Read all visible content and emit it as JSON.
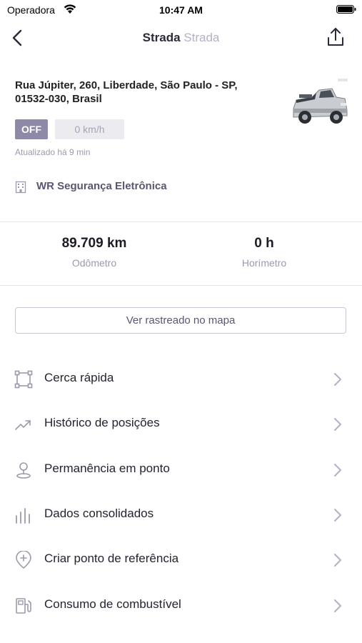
{
  "status_bar": {
    "carrier": "Operadora",
    "time": "10:47 AM"
  },
  "nav": {
    "title": "Strada",
    "subtitle": "Strada"
  },
  "vehicle": {
    "address": "Rua Júpiter, 260, Liberdade, São Paulo - SP, 01532-030, Brasil",
    "ignition": "OFF",
    "speed": "0 km/h",
    "updated": "Atualizado há 9 min",
    "company": "WR Segurança Eletrônica"
  },
  "stats": {
    "odometer_value": "89.709 km",
    "odometer_label": "Odômetro",
    "hourmeter_value": "0 h",
    "hourmeter_label": "Horímetro"
  },
  "map_button": "Ver rastreado no mapa",
  "menu": {
    "items": [
      {
        "label": "Cerca rápida",
        "icon": "fence-icon"
      },
      {
        "label": "Histórico de posições",
        "icon": "trend-icon"
      },
      {
        "label": "Permanência em ponto",
        "icon": "location-pin-icon"
      },
      {
        "label": "Dados consolidados",
        "icon": "bar-chart-icon"
      },
      {
        "label": "Criar ponto de referência",
        "icon": "add-location-icon"
      },
      {
        "label": "Consumo de combustível",
        "icon": "fuel-icon"
      }
    ]
  },
  "colors": {
    "accent": "#8f89a8",
    "icon": "#9d99ac",
    "text_primary": "#24242f",
    "divider": "#e3e1ea"
  }
}
